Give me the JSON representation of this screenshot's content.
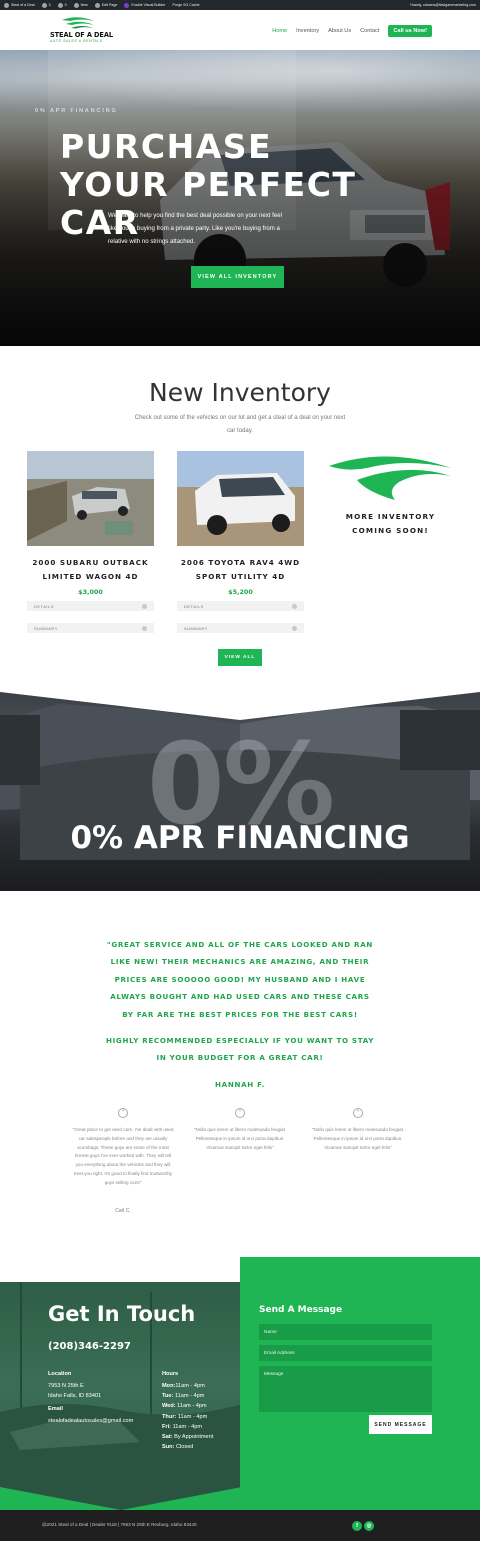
{
  "admin_bar": {
    "site": "Steal of a Deal",
    "updates": "3",
    "comments": "0",
    "new": "New",
    "edit": "Edit Page",
    "visual_builder": "Enable Visual Builder",
    "purge": "Purge SG Cache",
    "howdy": "Howdy, cdowns@flavigaremarketing.com"
  },
  "brand": {
    "name": "STEAL OF A DEAL",
    "tagline": "AUTO SALES & RENTALS",
    "accent": "#1fb555"
  },
  "nav": {
    "items": [
      "Home",
      "Inventory",
      "About Us",
      "Contact"
    ],
    "cta": "Call us Now!"
  },
  "hero": {
    "eyebrow": "0% APR FINANCING",
    "title": "PURCHASE YOUR PERFECT CAR",
    "description": "We want to help you find the best deal possible on your next feel like you're buying from a private party. Like you're buying from a relative with no strings attached.",
    "button": "VIEW ALL INVENTORY"
  },
  "inventory": {
    "title": "New Inventory",
    "intro": "Check out some of the vehicles on our lot and get a steal of a deal on your next car today.",
    "cars": [
      {
        "name": "2000 SUBARU OUTBACK LIMITED WAGON 4D",
        "price": "$3,000",
        "details": "DETAILS",
        "summary": "SUMMARY"
      },
      {
        "name": "2006 TOYOTA RAV4 4WD SPORT UTILITY 4D",
        "price": "$5,200",
        "details": "DETAILS",
        "summary": "SUMMARY"
      }
    ],
    "coming_soon": "MORE INVENTORY COMING SOON!",
    "view_all": "VIEW ALL"
  },
  "apr_banner": {
    "big": "0%",
    "label": "0% APR FINANCING"
  },
  "featured_quote": {
    "paragraphs": [
      "\"GREAT SERVICE AND ALL OF THE CARS LOOKED AND RAN LIKE NEW! THEIR MECHANICS ARE AMAZING, AND THEIR PRICES ARE SOOOOO GOOD! MY HUSBAND AND I HAVE ALWAYS BOUGHT AND HAD USED CARS AND THESE CARS BY FAR ARE THE BEST PRICES FOR THE BEST CARS!",
      "HIGHLY RECOMMENDED ESPECIALLY IF YOU WANT TO STAY IN YOUR BUDGET FOR A GREAT CAR!"
    ],
    "author": "HANNAH F."
  },
  "testimonials": [
    {
      "text": "\"Great place to get used cars. I've dealt with used car salespeople before and they are usually scumbags. These guys are some of the most honest guys I've ever worked with. They will tell you everything about the vehicles and they will treat you right. It's good to finally find trustworthy guys selling cars!\"",
      "author": "Carl C."
    },
    {
      "text": "\"Nulla quis lorem ut libero malesuada feugiat. Pellentesque in ipsum id orci porta dapibus. Vivamus suscipit tortor eget felis\"",
      "author": ""
    },
    {
      "text": "\"Nulla quis lorem ut libero malesuada feugiat. Pellentesque in ipsum id orci porta dapibus. Vivamus suscipit tortor eget felis\"",
      "author": ""
    }
  ],
  "contact": {
    "title": "Get In Touch",
    "phone": "(208)346-2297",
    "location_label": "Location",
    "address_line1": "7953 N 25th E",
    "address_line2": "Idaho Falls, ID 83401",
    "email_label": "Email",
    "email": "stealofadealautosales@gmail.com",
    "hours_label": "Hours",
    "hours": [
      {
        "day": "Mon:",
        "time": "11am - 4pm"
      },
      {
        "day": "Tue:",
        "time": "11am - 4pm"
      },
      {
        "day": "Wed:",
        "time": "11am - 4pm"
      },
      {
        "day": "Thur:",
        "time": "11am - 4pm"
      },
      {
        "day": "Fri:",
        "time": "11am - 4pm"
      },
      {
        "day": "Sat:",
        "time": "By Appointment"
      },
      {
        "day": "Sun:",
        "time": "Closed"
      }
    ]
  },
  "form": {
    "title": "Send A Message",
    "name_placeholder": "Name",
    "email_placeholder": "Email Address",
    "message_placeholder": "Message",
    "submit": "SEND MESSAGE"
  },
  "footer": {
    "copyright": "@2021 Steal of a Deal | Dealer #118 | 7953 N 25th E Rexburg, Idaho 83440",
    "social": [
      "f",
      "◎"
    ]
  }
}
